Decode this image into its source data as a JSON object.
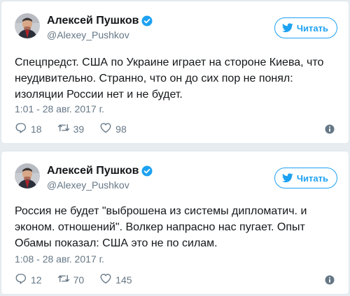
{
  "colors": {
    "accent": "#1da1f2",
    "muted": "#657786",
    "text": "#14171a",
    "background": "#e6ecf0"
  },
  "tweets": [
    {
      "display_name": "Алексей Пушков",
      "handle": "@Alexey_Pushkov",
      "follow_label": "Читать",
      "text": "Спецпредст. США по Украине играет на стороне Киева, что неудивительно. Странно, что он до сих пор не понял: изоляции России нет и не будет.",
      "timestamp": "1:01 - 28 авг. 2017 г.",
      "replies": "18",
      "retweets": "39",
      "likes": "98"
    },
    {
      "display_name": "Алексей Пушков",
      "handle": "@Alexey_Pushkov",
      "follow_label": "Читать",
      "text": "Россия не будет \"выброшена из системы дипломатич. и эконом. отношений\". Волкер напрасно нас пугает. Опыт Обамы показал: США это не по силам.",
      "timestamp": "1:08 - 28 авг. 2017 г.",
      "replies": "12",
      "retweets": "70",
      "likes": "145"
    }
  ],
  "icons": [
    "avatar",
    "verified-badge-icon",
    "twitter-bird-icon",
    "reply-icon",
    "retweet-icon",
    "heart-icon",
    "info-icon"
  ]
}
